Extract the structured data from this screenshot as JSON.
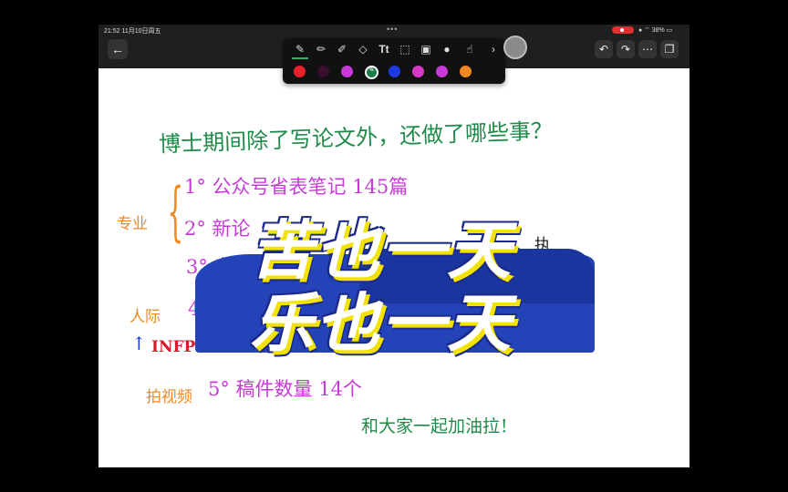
{
  "status_bar": {
    "time_date": "21:52  11月10日周五",
    "dots": "•••",
    "battery": "38%"
  },
  "toolbar": {
    "tools": [
      "pen-icon",
      "pencil-icon",
      "highlighter-icon",
      "eraser-icon",
      "text-tool",
      "lasso-icon",
      "image-icon",
      "mic-icon",
      "hand-icon",
      "chevron-right-icon"
    ],
    "text_tool_label": "Tt",
    "chevron": "›",
    "colors": [
      "#e8202a",
      "#3a0f2e",
      "#c83ad8",
      "#1f7a4a",
      "#1f3ae0",
      "#d838c8",
      "#c83ad8",
      "#ee8a22"
    ]
  },
  "controls": {
    "back": "←",
    "undo": "↶",
    "redo": "↷",
    "more": "⋯",
    "pages": "❐"
  },
  "note": {
    "title": "博士期间除了写论文外，还做了哪些事？",
    "side_label_top": "专业",
    "item1": "1° 公众号省表笔记  145篇",
    "item2": "2° 新论",
    "item3": "3° 专",
    "side_label_mid": "人际",
    "arrow": "↑",
    "infp": "INFP",
    "item4": "4",
    "side_label_bottom": "拍视频",
    "item5": "5° 稿件数量 14个",
    "closing": "和大家一起加油拉！",
    "right_fragment": "执"
  },
  "banner": {
    "line1": "苦也一天",
    "line2": "乐也一天"
  }
}
